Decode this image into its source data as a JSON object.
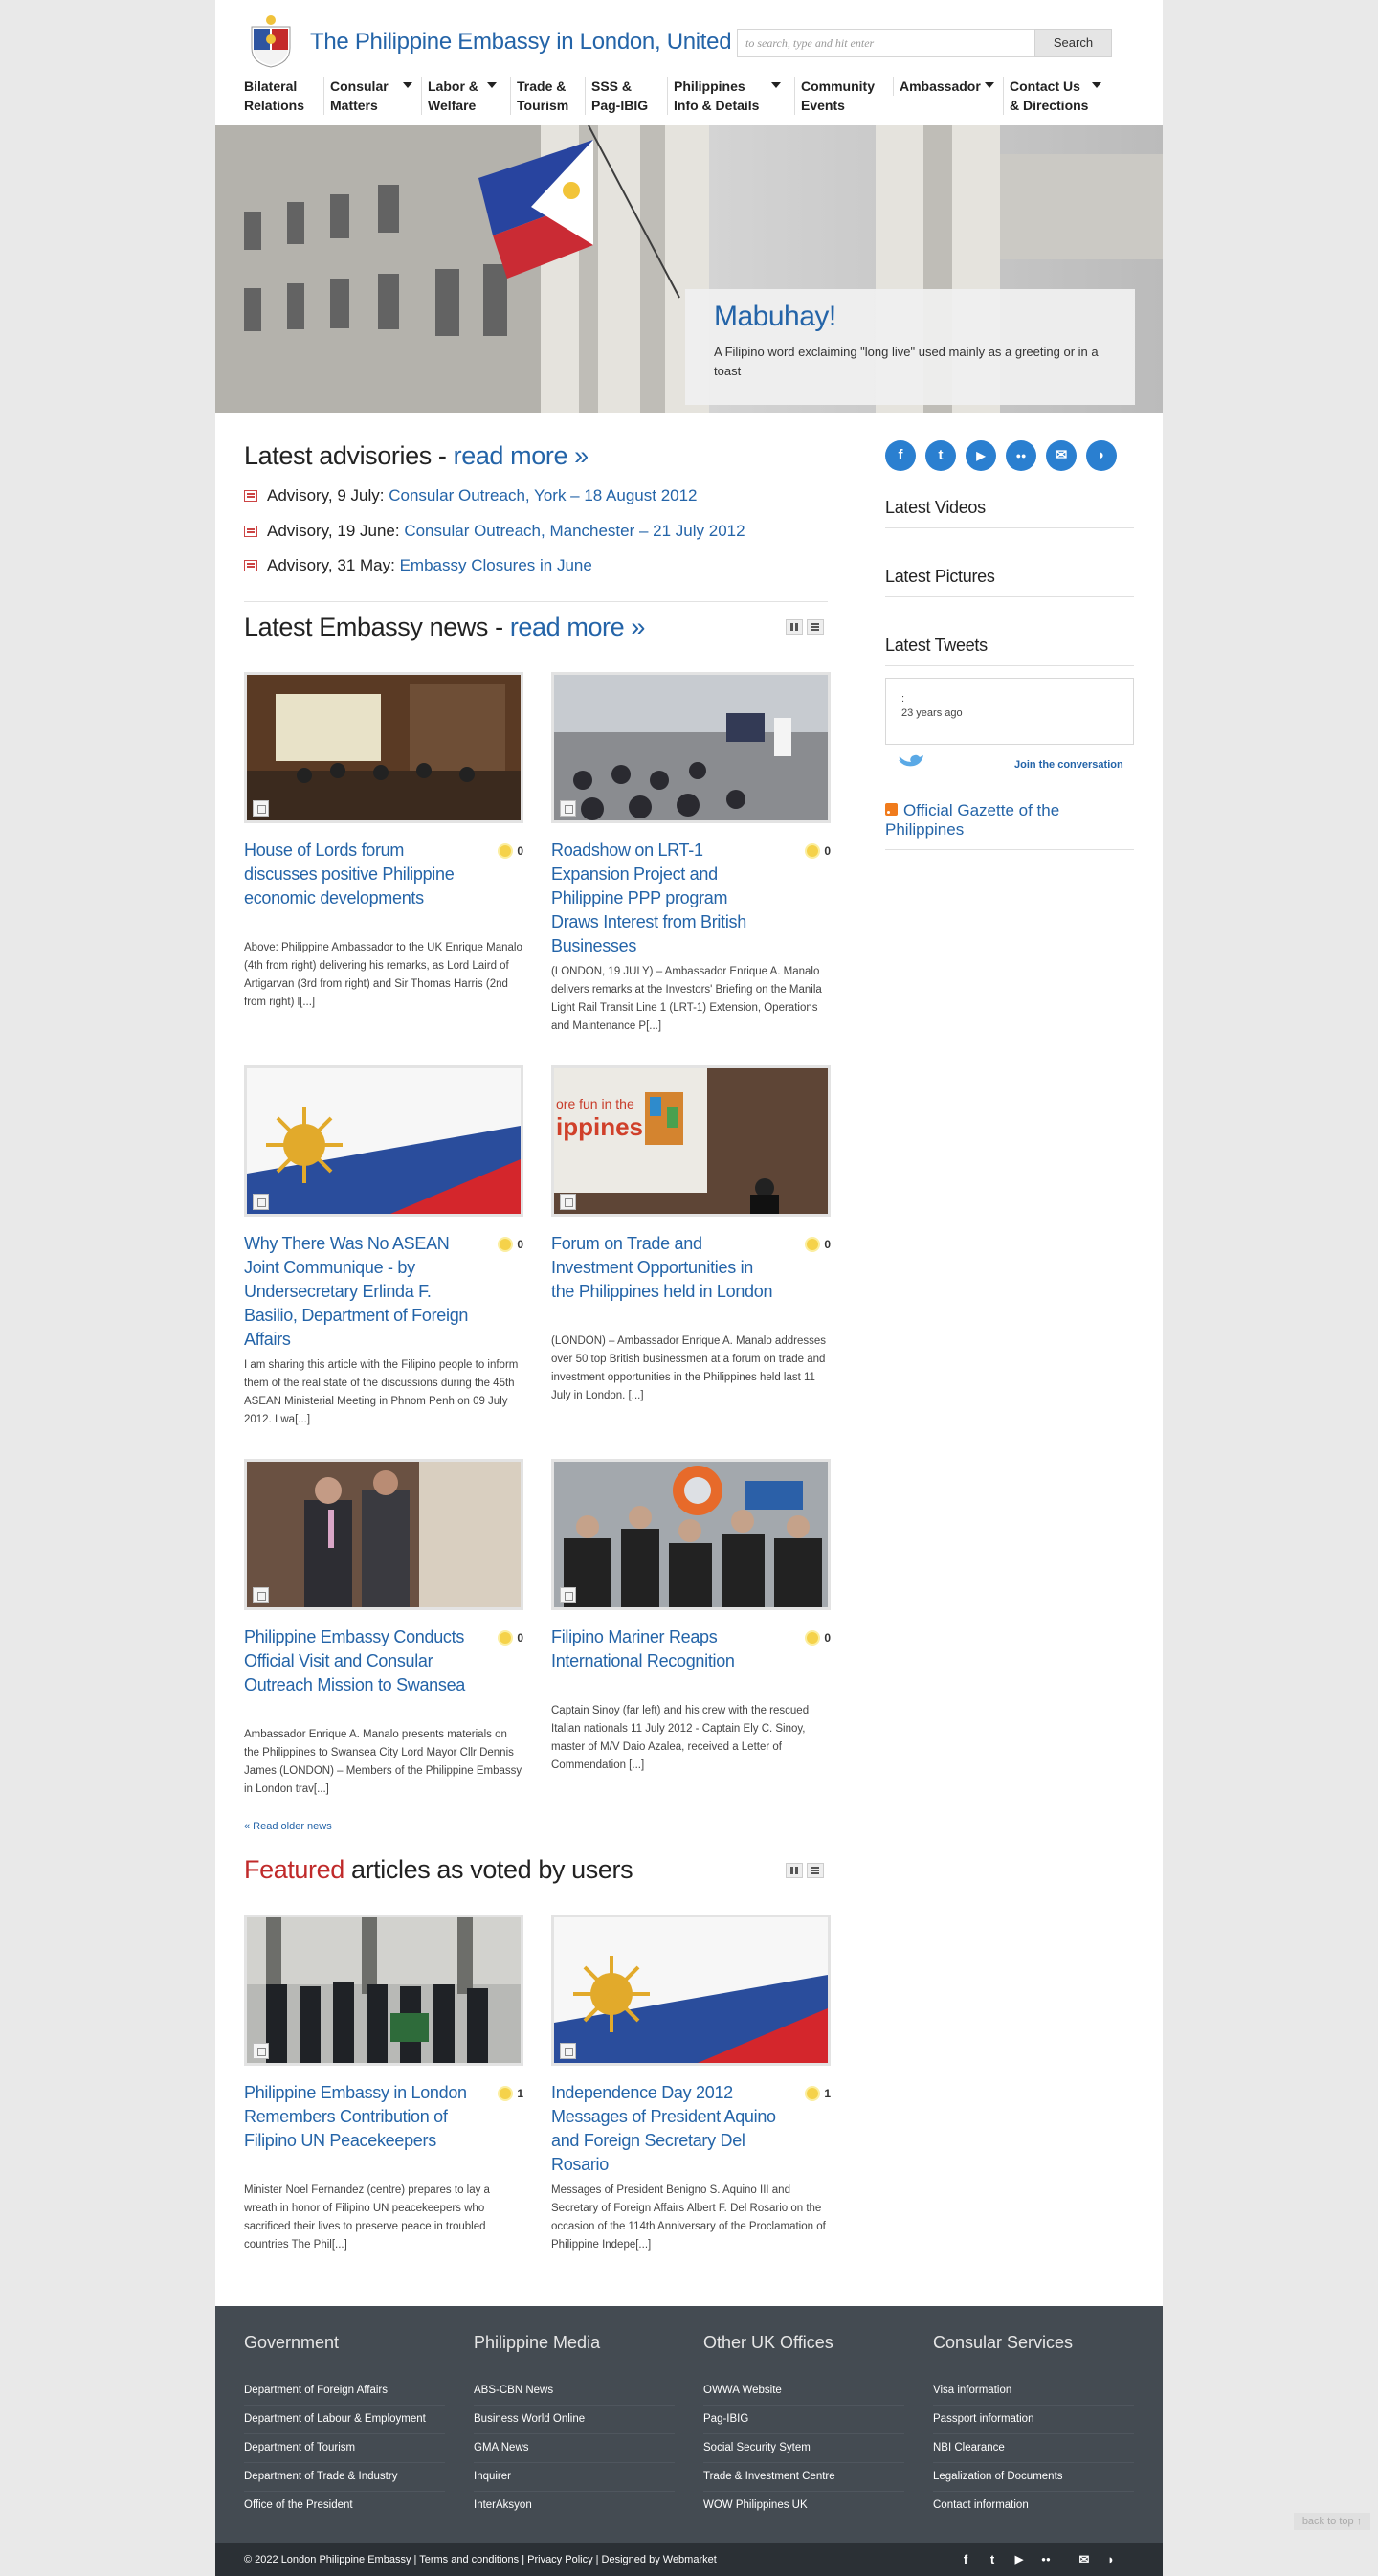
{
  "header": {
    "site_title": "The Philippine Embassy in London, United Kingdom",
    "search_placeholder": "to search, type and hit enter",
    "search_button": "Search"
  },
  "nav": [
    {
      "line1": "Bilateral",
      "line2": "Relations",
      "dropdown": false
    },
    {
      "line1": "Consular",
      "line2": "Matters",
      "dropdown": true
    },
    {
      "line1": "Labor &",
      "line2": "Welfare",
      "dropdown": true
    },
    {
      "line1": "Trade &",
      "line2": "Tourism",
      "dropdown": false
    },
    {
      "line1": "SSS &",
      "line2": "Pag-IBIG",
      "dropdown": false
    },
    {
      "line1": "Philippines",
      "line2": "Info & Details",
      "dropdown": true
    },
    {
      "line1": "Community",
      "line2": "Events",
      "dropdown": false
    },
    {
      "line1": "Ambassador",
      "line2": "",
      "dropdown": true
    },
    {
      "line1": "Contact Us",
      "line2": "& Directions",
      "dropdown": true
    }
  ],
  "hero": {
    "title": "Mabuhay!",
    "text": "A Filipino word exclaiming \"long live\" used mainly as a greeting or in a toast"
  },
  "advisories": {
    "title": "Latest advisories - ",
    "read_more": "read more »",
    "items": [
      {
        "prefix": "Advisory, 9 July: ",
        "link": "Consular Outreach, York – 18 August 2012"
      },
      {
        "prefix": "Advisory, 19 June: ",
        "link": "Consular Outreach, Manchester – 21 July 2012"
      },
      {
        "prefix": "Advisory, 31 May: ",
        "link": "Embassy Closures in June"
      }
    ]
  },
  "news": {
    "title": "Latest Embassy news - ",
    "read_more": "read more »",
    "items": [
      {
        "title": "House of Lords forum discusses positive Philippine economic developments",
        "votes": "0",
        "excerpt": "Above: Philippine Ambassador to the UK Enrique Manalo (4th from right) delivering his remarks, as Lord Laird of Artigarvan (3rd from right) and Sir Thomas Harris (2nd from right) l[...]"
      },
      {
        "title": "Roadshow on LRT-1 Expansion Project and Philippine PPP program Draws Interest from British Businesses",
        "votes": "0",
        "excerpt": "(LONDON, 19 JULY) – Ambassador Enrique A. Manalo delivers remarks at the Investors' Briefing on the Manila Light Rail Transit Line 1 (LRT-1) Extension, Operations and Maintenance P[...]"
      },
      {
        "title": "Why There Was No ASEAN Joint Communique - by Undersecretary Erlinda F. Basilio, Department of Foreign Affairs",
        "votes": "0",
        "excerpt": "I am sharing this article with the Filipino people to inform them of the real state of the discussions during the 45th ASEAN Ministerial Meeting in Phnom Penh on 09 July 2012. I wa[...]"
      },
      {
        "title": "Forum on Trade and Investment Opportunities in the Philippines held in London",
        "votes": "0",
        "excerpt": "(LONDON) – Ambassador Enrique A. Manalo addresses over 50 top British businessmen at a forum on trade and investment opportunities in the Philippines held last 11 July in London.  [...]"
      },
      {
        "title": "Philippine Embassy Conducts Official Visit and Consular Outreach Mission to Swansea",
        "votes": "0",
        "excerpt": "Ambassador Enrique A. Manalo presents materials on the Philippines to Swansea City Lord Mayor Cllr Dennis James    (LONDON) – Members of the Philippine Embassy in London trav[...]"
      },
      {
        "title": "Filipino Mariner Reaps International Recognition",
        "votes": "0",
        "excerpt": "Captain Sinoy (far left) and his crew with the rescued Italian nationals    11 July 2012 - Captain Ely C. Sinoy, master of M/V Daio Azalea, received a Letter of Commendation [...]"
      }
    ],
    "older": "« Read older news",
    "slide_text": "ore fun in the",
    "slide_text2": "ippines"
  },
  "featured": {
    "title_red": "Featured",
    "title_rest": " articles as voted by users",
    "items": [
      {
        "title": "Philippine Embassy in London Remembers Contribution of Filipino UN Peacekeepers",
        "votes": "1",
        "excerpt": "Minister Noel Fernandez (centre) prepares to lay a wreath in honor of Filipino UN peacekeepers who sacrificed their lives to preserve peace in troubled countries    The Phil[...]"
      },
      {
        "title": "Independence Day 2012 Messages of President Aquino and Foreign Secretary Del Rosario",
        "votes": "1",
        "excerpt": "Messages of President Benigno S. Aquino III and Secretary of Foreign Affairs Albert F. Del Rosario on the occasion of the 114th Anniversary of the Proclamation of Philippine Indepe[...]"
      }
    ]
  },
  "sidebar": {
    "social": [
      {
        "icon": "facebook-icon",
        "glyph": "f"
      },
      {
        "icon": "twitter-icon",
        "glyph": "t"
      },
      {
        "icon": "youtube-icon",
        "glyph": "▶"
      },
      {
        "icon": "flickr-icon",
        "glyph": "●●"
      },
      {
        "icon": "email-icon",
        "glyph": "✉"
      },
      {
        "icon": "rss-icon",
        "glyph": "◗"
      }
    ],
    "latest_videos": "Latest Videos",
    "latest_pictures": "Latest Pictures",
    "latest_tweets": "Latest Tweets",
    "tweet_colon": ":",
    "tweet_time": "23 years ago",
    "join": "Join the conversation",
    "gazette": "Official Gazette of the Philippines"
  },
  "footer": {
    "columns": [
      {
        "title": "Government",
        "links": [
          "Department of Foreign Affairs",
          "Department of Labour & Employment",
          "Department of Tourism",
          "Department of Trade & Industry",
          "Office of the President"
        ]
      },
      {
        "title": "Philippine Media",
        "links": [
          "ABS-CBN News",
          "Business World Online",
          "GMA News",
          "Inquirer",
          "InterAksyon"
        ]
      },
      {
        "title": "Other UK Offices",
        "links": [
          "OWWA Website",
          "Pag-IBIG",
          "Social Security Sytem",
          "Trade & Investment Centre",
          "WOW Philippines UK"
        ]
      },
      {
        "title": "Consular Services",
        "links": [
          "Visa information",
          "Passport information",
          "NBI Clearance",
          "Legalization of Documents",
          "Contact information"
        ]
      }
    ],
    "copyright": "© 2022 London Philippine Embassy | Terms and conditions | Privacy Policy | Designed by Webmarket",
    "back_to_top": "back to top ↑"
  },
  "colors": {
    "link": "#2464a8",
    "accent_red": "#c02a2a",
    "footer_bg": "#444b52",
    "social_blue": "#2a7fd0"
  }
}
